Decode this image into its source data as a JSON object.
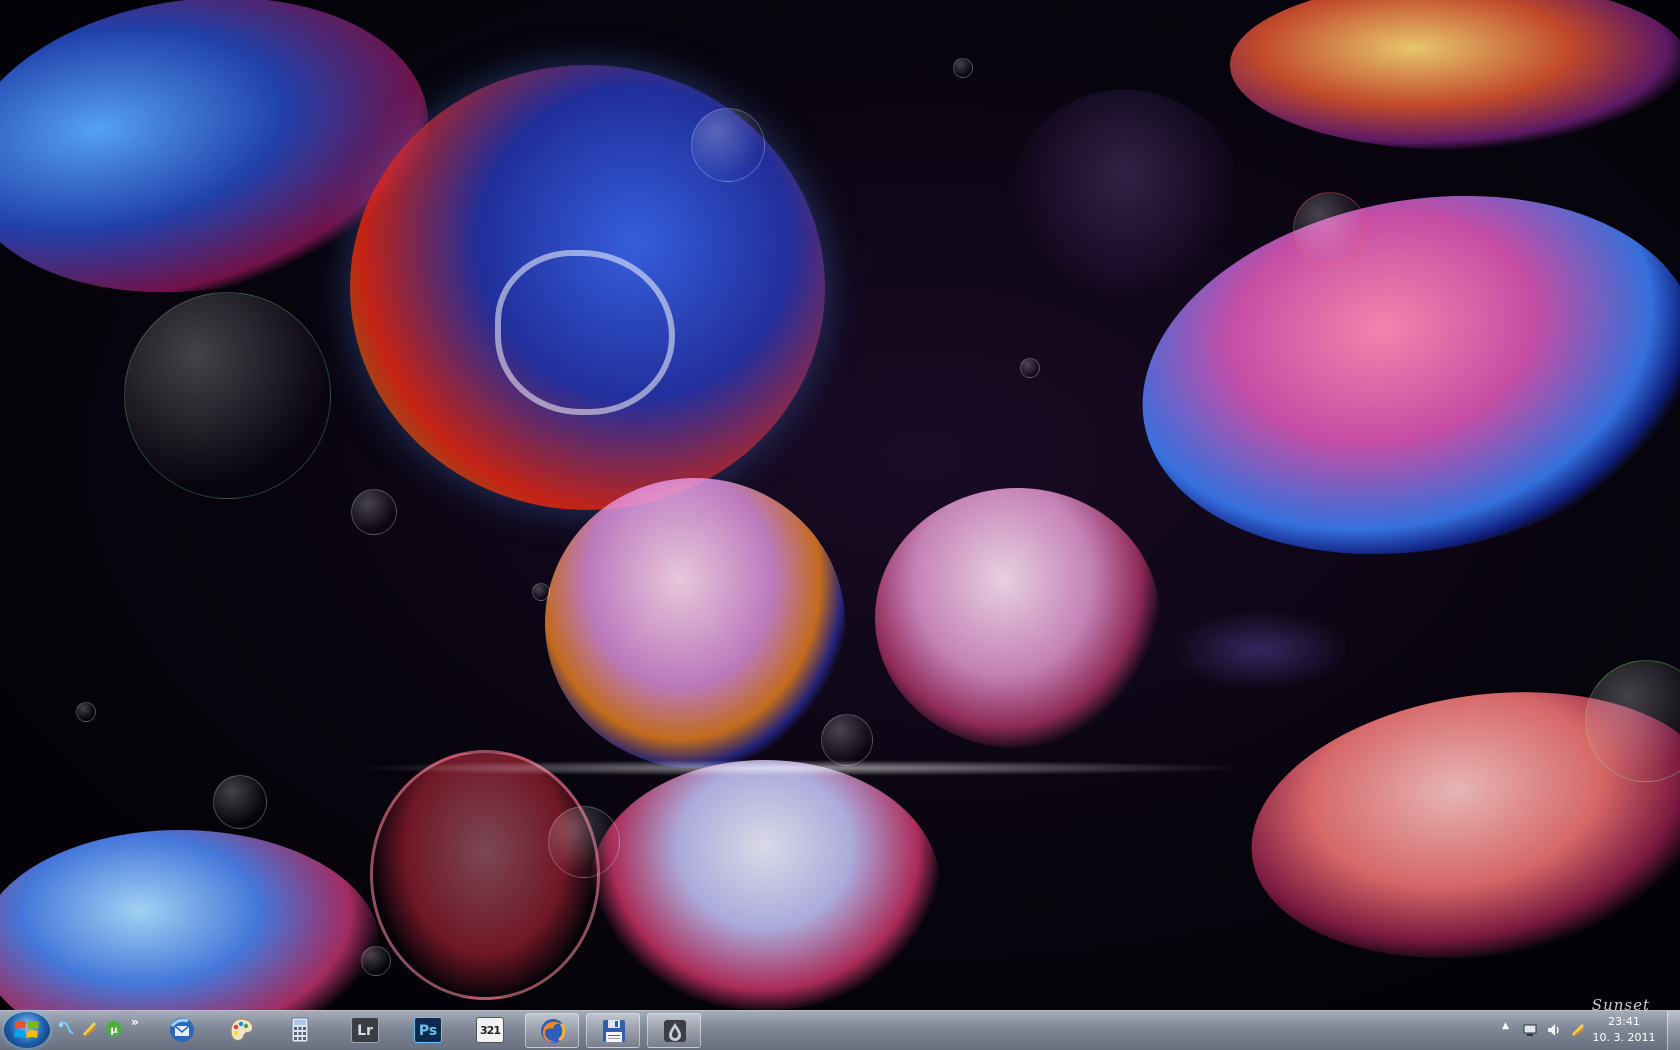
{
  "wallpaper": {
    "name": "jellyfish-wallpaper",
    "signature": "Sunset"
  },
  "taskbar": {
    "quick_launch_overflow": "»",
    "quick_launch": [
      {
        "name": "quick-launch-skype-icon",
        "color": "#3fb4f0"
      },
      {
        "name": "quick-launch-messenger-icon",
        "color": "#f0c030"
      },
      {
        "name": "quick-launch-utorrent-icon",
        "color": "#4cae3d"
      }
    ],
    "apps": [
      {
        "name": "thunderbird",
        "icon": "thunderbird-icon",
        "state": "pinned"
      },
      {
        "name": "paint",
        "icon": "paint-palette-icon",
        "state": "pinned"
      },
      {
        "name": "calculator",
        "icon": "calculator-icon",
        "state": "pinned"
      },
      {
        "name": "lightroom",
        "icon": "lightroom-icon",
        "label": "Lr",
        "state": "pinned"
      },
      {
        "name": "photoshop",
        "icon": "photoshop-icon",
        "label": "Ps",
        "state": "pinned"
      },
      {
        "name": "media-player-classic",
        "icon": "media-player-classic-icon",
        "label": "321",
        "state": "pinned"
      },
      {
        "name": "firefox",
        "icon": "firefox-icon",
        "state": "running"
      },
      {
        "name": "save-floppy",
        "icon": "floppy-disk-icon",
        "state": "running"
      },
      {
        "name": "steam-like",
        "icon": "dark-drop-icon",
        "state": "running"
      }
    ],
    "tray": {
      "chevron": "▲",
      "icons": [
        "network-icon",
        "volume-icon",
        "power-icon"
      ],
      "time": "23:41",
      "date": "10. 3. 2011"
    }
  }
}
